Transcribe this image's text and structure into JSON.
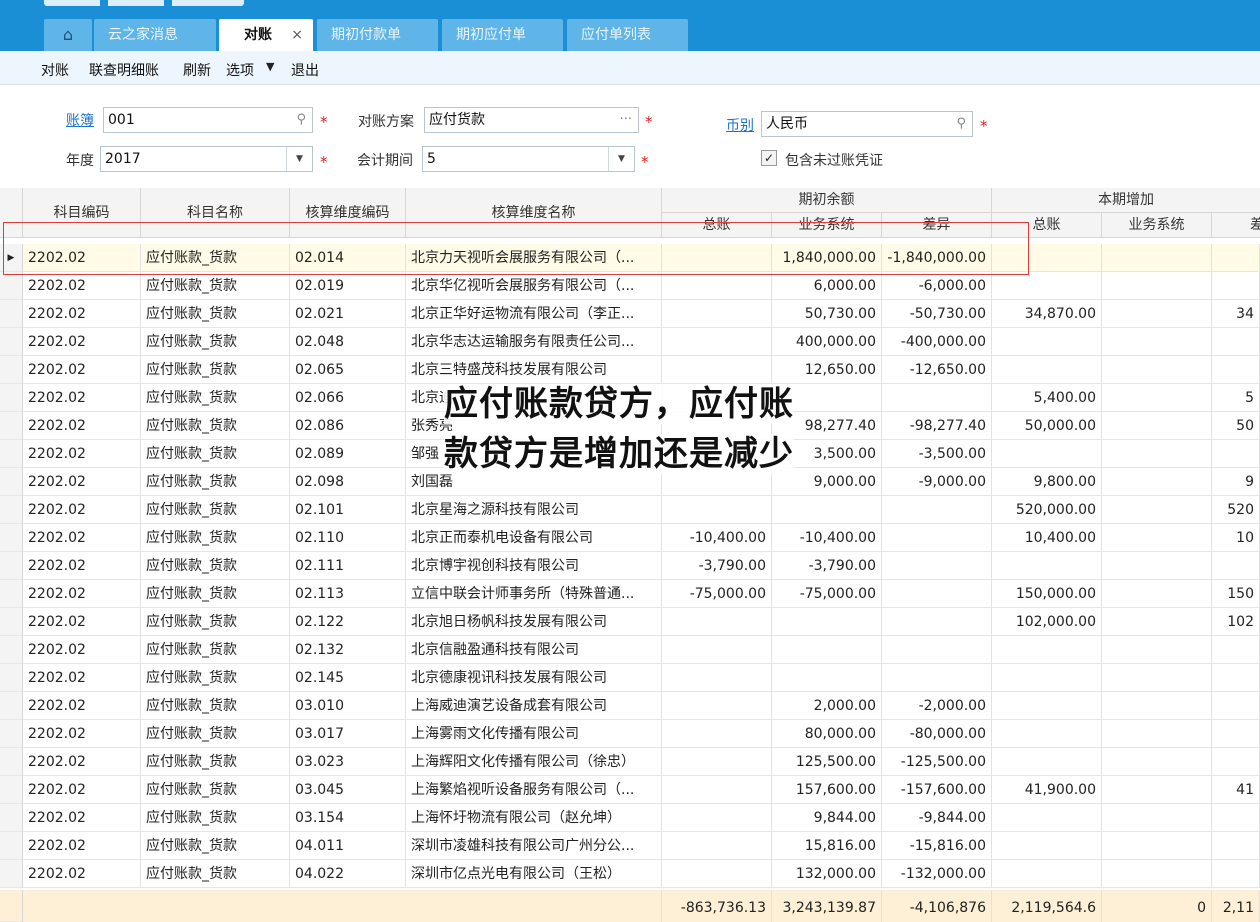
{
  "tabs": [
    {
      "label": "云之家消息"
    },
    {
      "label": "对账",
      "close": "×"
    },
    {
      "label": "期初付款单"
    },
    {
      "label": "期初应付单"
    },
    {
      "label": "应付单列表"
    }
  ],
  "home_icon": "⌂",
  "toolbar": {
    "items": [
      "对账",
      "联查明细账",
      "刷新",
      "选项",
      "退出"
    ],
    "dropdown_arrow": "▼"
  },
  "form": {
    "book_label": "账簿",
    "book_value": "001",
    "scheme_label": "对账方案",
    "scheme_value": "应付货款",
    "scheme_more": "···",
    "currency_label": "币别",
    "currency_value": "人民币",
    "year_label": "年度",
    "year_value": "2017",
    "period_label": "会计期间",
    "period_value": "5",
    "include_label": "包含未过账凭证",
    "include_checked": true,
    "required_mark": "*",
    "search_icon": "search-icon",
    "dropdown_icon": "▼",
    "check_mark": "✓"
  },
  "grid": {
    "headers": {
      "code": "科目编码",
      "name": "科目名称",
      "dim_code": "核算维度编码",
      "dim_name": "核算维度名称",
      "opening": "期初余额",
      "increase": "本期增加",
      "gl": "总账",
      "biz": "业务系统",
      "diff": "差异",
      "gl2": "总账",
      "biz2": "业务系统",
      "diff2": "差"
    },
    "row_arrow": "▶",
    "rows": [
      {
        "code": "2202.02",
        "name": "应付账款_货款",
        "dcode": "02.014",
        "dname": "北京力天视听会展服务有限公司（...",
        "gl": "",
        "biz": "1,840,000.00",
        "diff": "-1,840,000.00",
        "gl2": "",
        "biz2": "",
        "diff2": ""
      },
      {
        "code": "2202.02",
        "name": "应付账款_货款",
        "dcode": "02.019",
        "dname": "北京华亿视听会展服务有限公司（...",
        "gl": "",
        "biz": "6,000.00",
        "diff": "-6,000.00",
        "gl2": "",
        "biz2": "",
        "diff2": ""
      },
      {
        "code": "2202.02",
        "name": "应付账款_货款",
        "dcode": "02.021",
        "dname": "北京正华好运物流有限公司（李正...",
        "gl": "",
        "biz": "50,730.00",
        "diff": "-50,730.00",
        "gl2": "34,870.00",
        "biz2": "",
        "diff2": "34"
      },
      {
        "code": "2202.02",
        "name": "应付账款_货款",
        "dcode": "02.048",
        "dname": "北京华志达运输服务有限责任公司...",
        "gl": "",
        "biz": "400,000.00",
        "diff": "-400,000.00",
        "gl2": "",
        "biz2": "",
        "diff2": ""
      },
      {
        "code": "2202.02",
        "name": "应付账款_货款",
        "dcode": "02.065",
        "dname": "北京三特盛茂科技发展有限公司",
        "gl": "",
        "biz": "12,650.00",
        "diff": "-12,650.00",
        "gl2": "",
        "biz2": "",
        "diff2": ""
      },
      {
        "code": "2202.02",
        "name": "应付账款_货款",
        "dcode": "02.066",
        "dname": "北京迪",
        "gl": "",
        "biz": "",
        "diff": "",
        "gl2": "5,400.00",
        "biz2": "",
        "diff2": "5"
      },
      {
        "code": "2202.02",
        "name": "应付账款_货款",
        "dcode": "02.086",
        "dname": "张秀亮",
        "gl": "",
        "biz": "98,277.40",
        "diff": "-98,277.40",
        "gl2": "50,000.00",
        "biz2": "",
        "diff2": "50"
      },
      {
        "code": "2202.02",
        "name": "应付账款_货款",
        "dcode": "02.089",
        "dname": "邹强",
        "gl": "",
        "biz": "3,500.00",
        "diff": "-3,500.00",
        "gl2": "",
        "biz2": "",
        "diff2": ""
      },
      {
        "code": "2202.02",
        "name": "应付账款_货款",
        "dcode": "02.098",
        "dname": "刘国磊",
        "gl": "",
        "biz": "9,000.00",
        "diff": "-9,000.00",
        "gl2": "9,800.00",
        "biz2": "",
        "diff2": "9"
      },
      {
        "code": "2202.02",
        "name": "应付账款_货款",
        "dcode": "02.101",
        "dname": "北京星海之源科技有限公司",
        "gl": "",
        "biz": "",
        "diff": "",
        "gl2": "520,000.00",
        "biz2": "",
        "diff2": "520"
      },
      {
        "code": "2202.02",
        "name": "应付账款_货款",
        "dcode": "02.110",
        "dname": "北京正而泰机电设备有限公司",
        "gl": "-10,400.00",
        "biz": "-10,400.00",
        "diff": "",
        "gl2": "10,400.00",
        "biz2": "",
        "diff2": "10"
      },
      {
        "code": "2202.02",
        "name": "应付账款_货款",
        "dcode": "02.111",
        "dname": "北京博宇视创科技有限公司",
        "gl": "-3,790.00",
        "biz": "-3,790.00",
        "diff": "",
        "gl2": "",
        "biz2": "",
        "diff2": ""
      },
      {
        "code": "2202.02",
        "name": "应付账款_货款",
        "dcode": "02.113",
        "dname": "立信中联会计师事务所（特殊普通...",
        "gl": "-75,000.00",
        "biz": "-75,000.00",
        "diff": "",
        "gl2": "150,000.00",
        "biz2": "",
        "diff2": "150"
      },
      {
        "code": "2202.02",
        "name": "应付账款_货款",
        "dcode": "02.122",
        "dname": "北京旭日杨帆科技发展有限公司",
        "gl": "",
        "biz": "",
        "diff": "",
        "gl2": "102,000.00",
        "biz2": "",
        "diff2": "102"
      },
      {
        "code": "2202.02",
        "name": "应付账款_货款",
        "dcode": "02.132",
        "dname": "北京信融盈通科技有限公司",
        "gl": "",
        "biz": "",
        "diff": "",
        "gl2": "",
        "biz2": "",
        "diff2": ""
      },
      {
        "code": "2202.02",
        "name": "应付账款_货款",
        "dcode": "02.145",
        "dname": "北京德康视讯科技发展有限公司",
        "gl": "",
        "biz": "",
        "diff": "",
        "gl2": "",
        "biz2": "",
        "diff2": ""
      },
      {
        "code": "2202.02",
        "name": "应付账款_货款",
        "dcode": "03.010",
        "dname": "上海威迪演艺设备成套有限公司",
        "gl": "",
        "biz": "2,000.00",
        "diff": "-2,000.00",
        "gl2": "",
        "biz2": "",
        "diff2": ""
      },
      {
        "code": "2202.02",
        "name": "应付账款_货款",
        "dcode": "03.017",
        "dname": "上海雾雨文化传播有限公司",
        "gl": "",
        "biz": "80,000.00",
        "diff": "-80,000.00",
        "gl2": "",
        "biz2": "",
        "diff2": ""
      },
      {
        "code": "2202.02",
        "name": "应付账款_货款",
        "dcode": "03.023",
        "dname": "上海辉阳文化传播有限公司（徐忠）",
        "gl": "",
        "biz": "125,500.00",
        "diff": "-125,500.00",
        "gl2": "",
        "biz2": "",
        "diff2": ""
      },
      {
        "code": "2202.02",
        "name": "应付账款_货款",
        "dcode": "03.045",
        "dname": "上海繁焰视听设备服务有限公司（...",
        "gl": "",
        "biz": "157,600.00",
        "diff": "-157,600.00",
        "gl2": "41,900.00",
        "biz2": "",
        "diff2": "41"
      },
      {
        "code": "2202.02",
        "name": "应付账款_货款",
        "dcode": "03.154",
        "dname": "上海怀圩物流有限公司（赵允坤）",
        "gl": "",
        "biz": "9,844.00",
        "diff": "-9,844.00",
        "gl2": "",
        "biz2": "",
        "diff2": ""
      },
      {
        "code": "2202.02",
        "name": "应付账款_货款",
        "dcode": "04.011",
        "dname": "深圳市凌雄科技有限公司广州分公...",
        "gl": "",
        "biz": "15,816.00",
        "diff": "-15,816.00",
        "gl2": "",
        "biz2": "",
        "diff2": ""
      },
      {
        "code": "2202.02",
        "name": "应付账款_货款",
        "dcode": "04.022",
        "dname": "深圳市亿点光电有限公司（王松）",
        "gl": "",
        "biz": "132,000.00",
        "diff": "-132,000.00",
        "gl2": "",
        "biz2": "",
        "diff2": ""
      }
    ],
    "totals": {
      "gl": "-863,736.13",
      "biz": "3,243,139.87",
      "diff": "-4,106,876",
      "gl2": "2,119,564.6",
      "biz2": "0",
      "diff2": "2,11"
    }
  },
  "overlay": {
    "line1": "应付账款贷方，应付账",
    "line2": "款贷方是增加还是减少"
  },
  "colors": {
    "top_band": "#1a8fd6",
    "tab_inactive": "#5fb4e8",
    "selection_border": "#e23b3b",
    "totals_bg": "#fdf0d6",
    "link": "#1b75c9"
  }
}
